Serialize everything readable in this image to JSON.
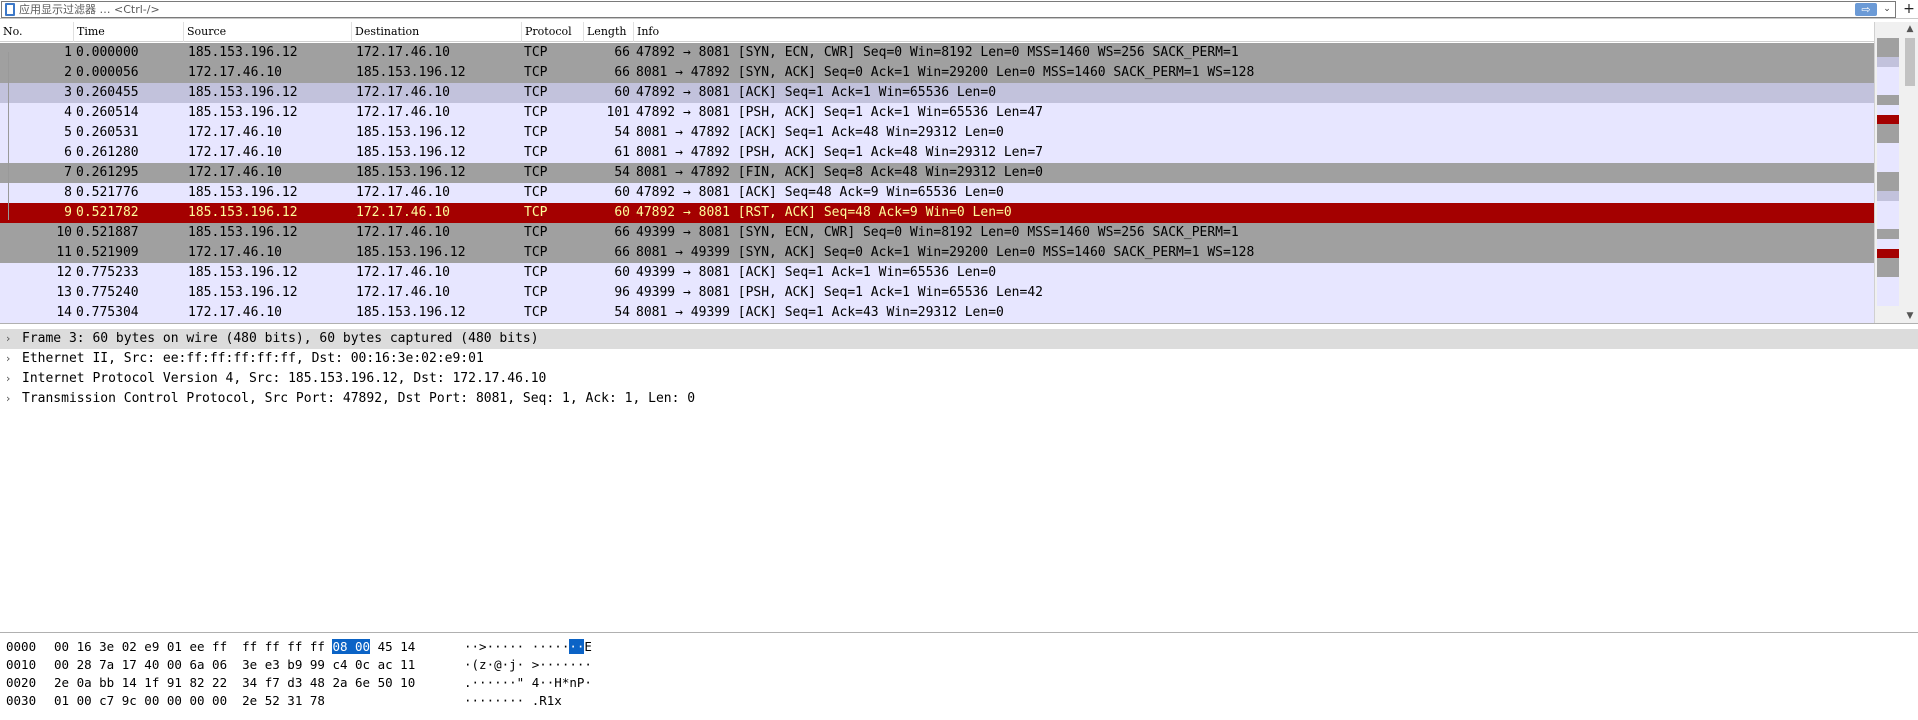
{
  "filter": {
    "placeholder": "应用显示过滤器 … <Ctrl-/>",
    "apply_label": "⇨",
    "dropdown_label": "⌄",
    "add_label": "+"
  },
  "columns": [
    "No.",
    "Time",
    "Source",
    "Destination",
    "Protocol",
    "Length",
    "Info"
  ],
  "colors": {
    "syn_fin_bg": "#a0a0a0",
    "tcp_bg": "#e7e6ff",
    "selected_bg": "#c2c2dc",
    "rst_bg": "#a40000",
    "rst_fg": "#fffc9c"
  },
  "packets": [
    {
      "no": "1",
      "time": "0.000000",
      "src": "185.153.196.12",
      "dst": "172.17.46.10",
      "proto": "TCP",
      "len": "66",
      "info": "47892 → 8081 [SYN, ECN, CWR] Seq=0 Win=8192 Len=0 MSS=1460 WS=256 SACK_PERM=1",
      "style": "gray"
    },
    {
      "no": "2",
      "time": "0.000056",
      "src": "172.17.46.10",
      "dst": "185.153.196.12",
      "proto": "TCP",
      "len": "66",
      "info": "8081 → 47892 [SYN, ACK] Seq=0 Ack=1 Win=29200 Len=0 MSS=1460 SACK_PERM=1 WS=128",
      "style": "gray"
    },
    {
      "no": "3",
      "time": "0.260455",
      "src": "185.153.196.12",
      "dst": "172.17.46.10",
      "proto": "TCP",
      "len": "60",
      "info": "47892 → 8081 [ACK] Seq=1 Ack=1 Win=65536 Len=0",
      "style": "sel"
    },
    {
      "no": "4",
      "time": "0.260514",
      "src": "185.153.196.12",
      "dst": "172.17.46.10",
      "proto": "TCP",
      "len": "101",
      "info": "47892 → 8081 [PSH, ACK] Seq=1 Ack=1 Win=65536 Len=47",
      "style": "tcp"
    },
    {
      "no": "5",
      "time": "0.260531",
      "src": "172.17.46.10",
      "dst": "185.153.196.12",
      "proto": "TCP",
      "len": "54",
      "info": "8081 → 47892 [ACK] Seq=1 Ack=48 Win=29312 Len=0",
      "style": "tcp"
    },
    {
      "no": "6",
      "time": "0.261280",
      "src": "172.17.46.10",
      "dst": "185.153.196.12",
      "proto": "TCP",
      "len": "61",
      "info": "8081 → 47892 [PSH, ACK] Seq=1 Ack=48 Win=29312 Len=7",
      "style": "tcp"
    },
    {
      "no": "7",
      "time": "0.261295",
      "src": "172.17.46.10",
      "dst": "185.153.196.12",
      "proto": "TCP",
      "len": "54",
      "info": "8081 → 47892 [FIN, ACK] Seq=8 Ack=48 Win=29312 Len=0",
      "style": "gray"
    },
    {
      "no": "8",
      "time": "0.521776",
      "src": "185.153.196.12",
      "dst": "172.17.46.10",
      "proto": "TCP",
      "len": "60",
      "info": "47892 → 8081 [ACK] Seq=48 Ack=9 Win=65536 Len=0",
      "style": "tcp"
    },
    {
      "no": "9",
      "time": "0.521782",
      "src": "185.153.196.12",
      "dst": "172.17.46.10",
      "proto": "TCP",
      "len": "60",
      "info": "47892 → 8081 [RST, ACK] Seq=48 Ack=9 Win=0 Len=0",
      "style": "rst"
    },
    {
      "no": "10",
      "time": "0.521887",
      "src": "185.153.196.12",
      "dst": "172.17.46.10",
      "proto": "TCP",
      "len": "66",
      "info": "49399 → 8081 [SYN, ECN, CWR] Seq=0 Win=8192 Len=0 MSS=1460 WS=256 SACK_PERM=1",
      "style": "gray"
    },
    {
      "no": "11",
      "time": "0.521909",
      "src": "172.17.46.10",
      "dst": "185.153.196.12",
      "proto": "TCP",
      "len": "66",
      "info": "8081 → 49399 [SYN, ACK] Seq=0 Ack=1 Win=29200 Len=0 MSS=1460 SACK_PERM=1 WS=128",
      "style": "gray"
    },
    {
      "no": "12",
      "time": "0.775233",
      "src": "185.153.196.12",
      "dst": "172.17.46.10",
      "proto": "TCP",
      "len": "60",
      "info": "49399 → 8081 [ACK] Seq=1 Ack=1 Win=65536 Len=0",
      "style": "tcp"
    },
    {
      "no": "13",
      "time": "0.775240",
      "src": "185.153.196.12",
      "dst": "172.17.46.10",
      "proto": "TCP",
      "len": "96",
      "info": "49399 → 8081 [PSH, ACK] Seq=1 Ack=1 Win=65536 Len=42",
      "style": "tcp"
    },
    {
      "no": "14",
      "time": "0.775304",
      "src": "172.17.46.10",
      "dst": "185.153.196.12",
      "proto": "TCP",
      "len": "54",
      "info": "8081 → 49399 [ACK] Seq=1 Ack=43 Win=29312 Len=0",
      "style": "tcp"
    }
  ],
  "details": [
    {
      "text": "Frame 3: 60 bytes on wire (480 bits), 60 bytes captured (480 bits)",
      "selected": true
    },
    {
      "text": "Ethernet II, Src: ee:ff:ff:ff:ff:ff, Dst: 00:16:3e:02:e9:01",
      "selected": false
    },
    {
      "text": "Internet Protocol Version 4, Src: 185.153.196.12, Dst: 172.17.46.10",
      "selected": false
    },
    {
      "text": "Transmission Control Protocol, Src Port: 47892, Dst Port: 8081, Seq: 1, Ack: 1, Len: 0",
      "selected": false
    }
  ],
  "bytes": [
    {
      "offset": "0000",
      "hex_pre": "00 16 3e 02 e9 01 ee ff  ff ff ff ff ",
      "hex_hl": "08 00",
      "hex_post": " 45 14",
      "ascii_pre": "··>····· ·····",
      "ascii_hl": "··",
      "ascii_post": "E"
    },
    {
      "offset": "0010",
      "hex_pre": "00 28 7a 17 40 00 6a 06  3e e3 b9 99 c4 0c ac 11",
      "hex_hl": "",
      "hex_post": "",
      "ascii_pre": "·(z·@·j· >·······",
      "ascii_hl": "",
      "ascii_post": ""
    },
    {
      "offset": "0020",
      "hex_pre": "2e 0a bb 14 1f 91 82 22  34 f7 d3 48 2a 6e 50 10",
      "hex_hl": "",
      "hex_post": "",
      "ascii_pre": ".······\" 4··H*nP·",
      "ascii_hl": "",
      "ascii_post": ""
    },
    {
      "offset": "0030",
      "hex_pre": "01 00 c7 9c 00 00 00 00  2e 52 31 78",
      "hex_hl": "",
      "hex_post": "",
      "ascii_pre": "········ .R1x",
      "ascii_hl": "",
      "ascii_post": ""
    }
  ]
}
